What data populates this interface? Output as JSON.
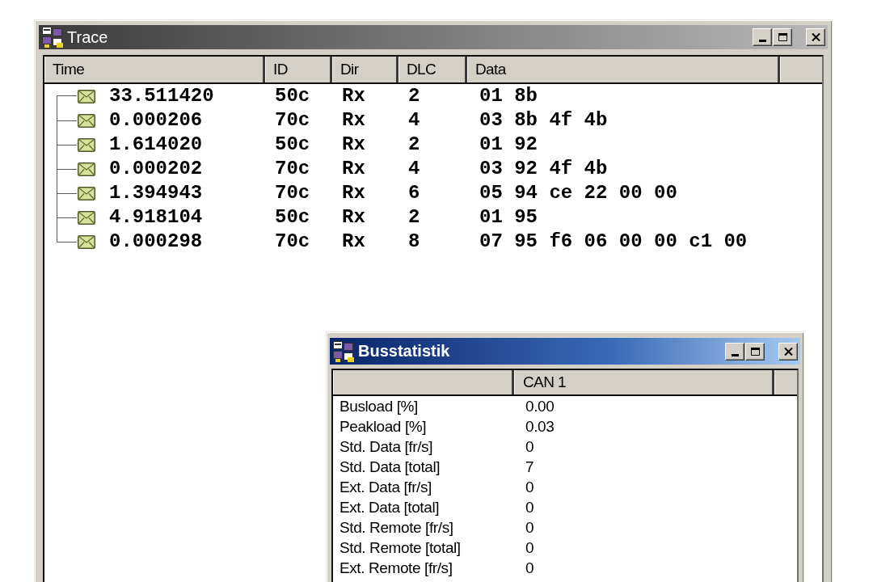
{
  "trace_window": {
    "title": "Trace",
    "active": false,
    "columns": [
      "Time",
      "ID",
      "Dir",
      "DLC",
      "Data"
    ],
    "rows": [
      {
        "time": "33.511420",
        "id": "50c",
        "dir": "Rx",
        "dlc": "2",
        "data": "01 8b"
      },
      {
        "time": "0.000206",
        "id": "70c",
        "dir": "Rx",
        "dlc": "4",
        "data": "03 8b 4f 4b"
      },
      {
        "time": "1.614020",
        "id": "50c",
        "dir": "Rx",
        "dlc": "2",
        "data": "01 92"
      },
      {
        "time": "0.000202",
        "id": "70c",
        "dir": "Rx",
        "dlc": "4",
        "data": "03 92 4f 4b"
      },
      {
        "time": "1.394943",
        "id": "70c",
        "dir": "Rx",
        "dlc": "6",
        "data": "05 94 ce 22 00 00"
      },
      {
        "time": "4.918104",
        "id": "50c",
        "dir": "Rx",
        "dlc": "2",
        "data": "01 95"
      },
      {
        "time": "0.000298",
        "id": "70c",
        "dir": "Rx",
        "dlc": "8",
        "data": "07 95 f6 06 00 00 c1 00"
      }
    ]
  },
  "bus_statistics_window": {
    "title": "Busstatistik",
    "active": true,
    "columns": [
      "CAN 1"
    ],
    "rows": [
      {
        "label": "Busload [%]",
        "value": "0.00"
      },
      {
        "label": "Peakload [%]",
        "value": "0.03"
      },
      {
        "label": "Std. Data [fr/s]",
        "value": "0"
      },
      {
        "label": "Std. Data [total]",
        "value": "7"
      },
      {
        "label": "Ext. Data [fr/s]",
        "value": "0"
      },
      {
        "label": "Ext. Data [total]",
        "value": "0"
      },
      {
        "label": "Std. Remote [fr/s]",
        "value": "0"
      },
      {
        "label": "Std. Remote [total]",
        "value": "0"
      },
      {
        "label": "Ext. Remote [fr/s]",
        "value": "0"
      }
    ]
  }
}
